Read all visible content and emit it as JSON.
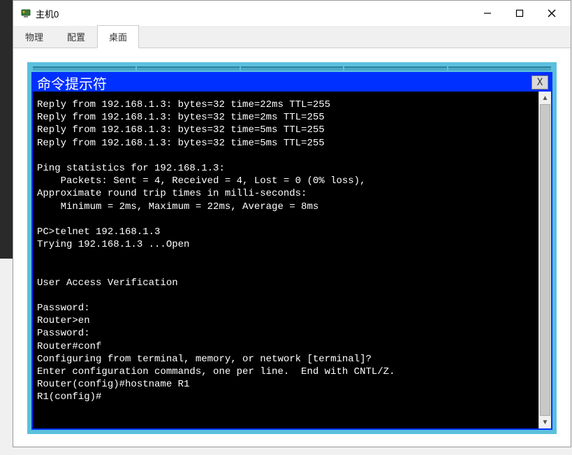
{
  "window": {
    "title": "主机0"
  },
  "tabs": [
    {
      "label": "物理",
      "active": false
    },
    {
      "label": "配置",
      "active": false
    },
    {
      "label": "桌面",
      "active": true
    }
  ],
  "terminal": {
    "title": "命令提示符",
    "close_label": "X",
    "content": "Reply from 192.168.1.3: bytes=32 time=22ms TTL=255\nReply from 192.168.1.3: bytes=32 time=2ms TTL=255\nReply from 192.168.1.3: bytes=32 time=5ms TTL=255\nReply from 192.168.1.3: bytes=32 time=5ms TTL=255\n\nPing statistics for 192.168.1.3:\n    Packets: Sent = 4, Received = 4, Lost = 0 (0% loss),\nApproximate round trip times in milli-seconds:\n    Minimum = 2ms, Maximum = 22ms, Average = 8ms\n\nPC>telnet 192.168.1.3\nTrying 192.168.1.3 ...Open\n\n\nUser Access Verification\n\nPassword: \nRouter>en\nPassword: \nRouter#conf\nConfiguring from terminal, memory, or network [terminal]? \nEnter configuration commands, one per line.  End with CNTL/Z.\nRouter(config)#hostname R1\nR1(config)#"
  }
}
